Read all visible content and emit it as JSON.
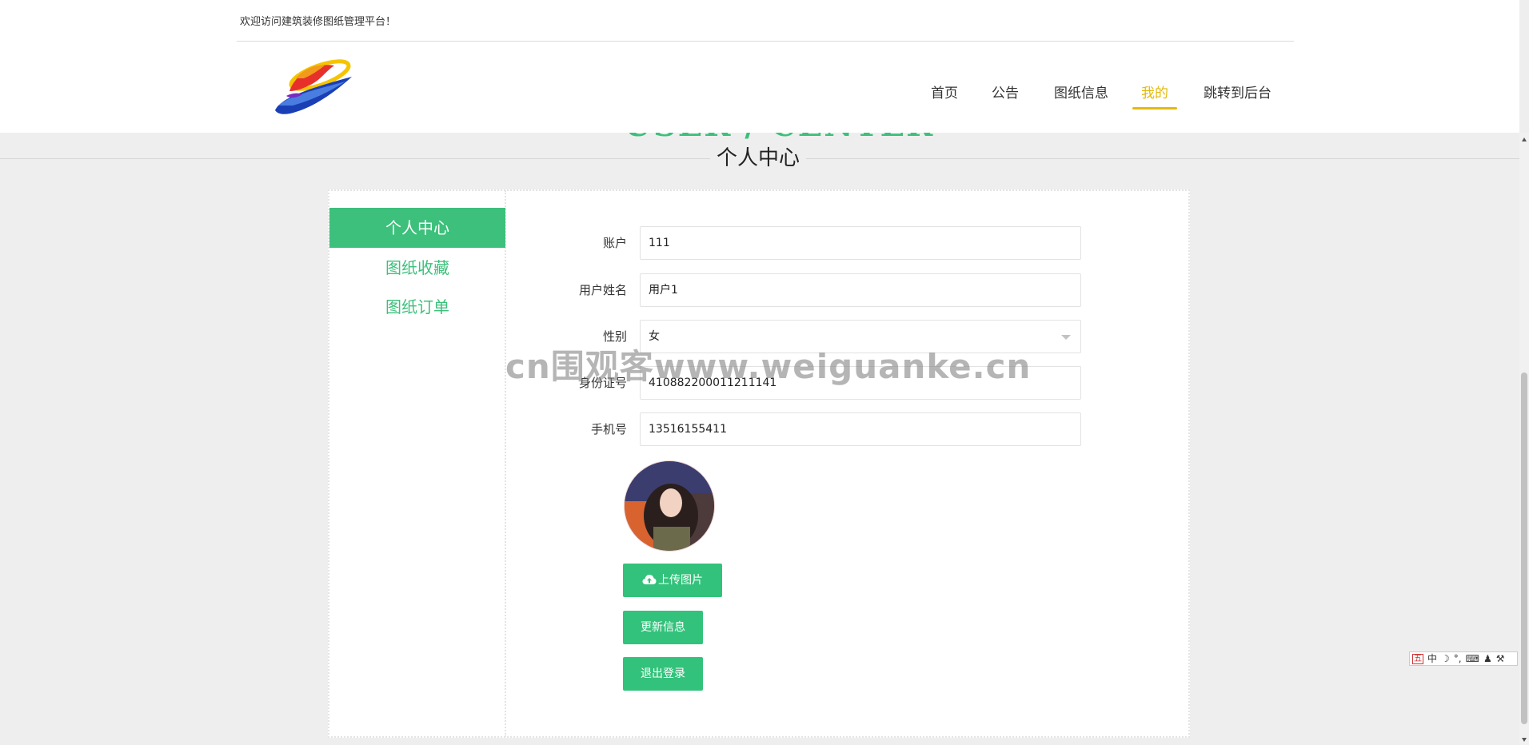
{
  "header": {
    "welcome": "欢迎访问建筑装修图纸管理平台！",
    "nav": [
      "首页",
      "公告",
      "图纸信息",
      "我的",
      "跳转到后台"
    ],
    "active_nav": "我的",
    "accent_color": "#e3b90f"
  },
  "title": {
    "en": "USER / CENTER",
    "cn": "个人中心"
  },
  "sidebar": {
    "items": [
      {
        "label": "个人中心",
        "active": true
      },
      {
        "label": "图纸收藏",
        "active": false
      },
      {
        "label": "图纸订单",
        "active": false
      }
    ]
  },
  "form": {
    "account_label": "账户",
    "account_value": "111",
    "name_label": "用户姓名",
    "name_value": "用户1",
    "gender_label": "性别",
    "gender_value": "女",
    "idcard_label": "身份证号",
    "idcard_value": "410882200011211141",
    "phone_label": "手机号",
    "phone_value": "13516155411"
  },
  "buttons": {
    "upload": "上传图片",
    "update": "更新信息",
    "logout": "退出登录"
  },
  "watermark": "cn围观客www.weiguanke.cn",
  "ime": {
    "mode": "中"
  },
  "colors": {
    "primary": "#33c27b",
    "page_bg": "#eeeeee"
  }
}
